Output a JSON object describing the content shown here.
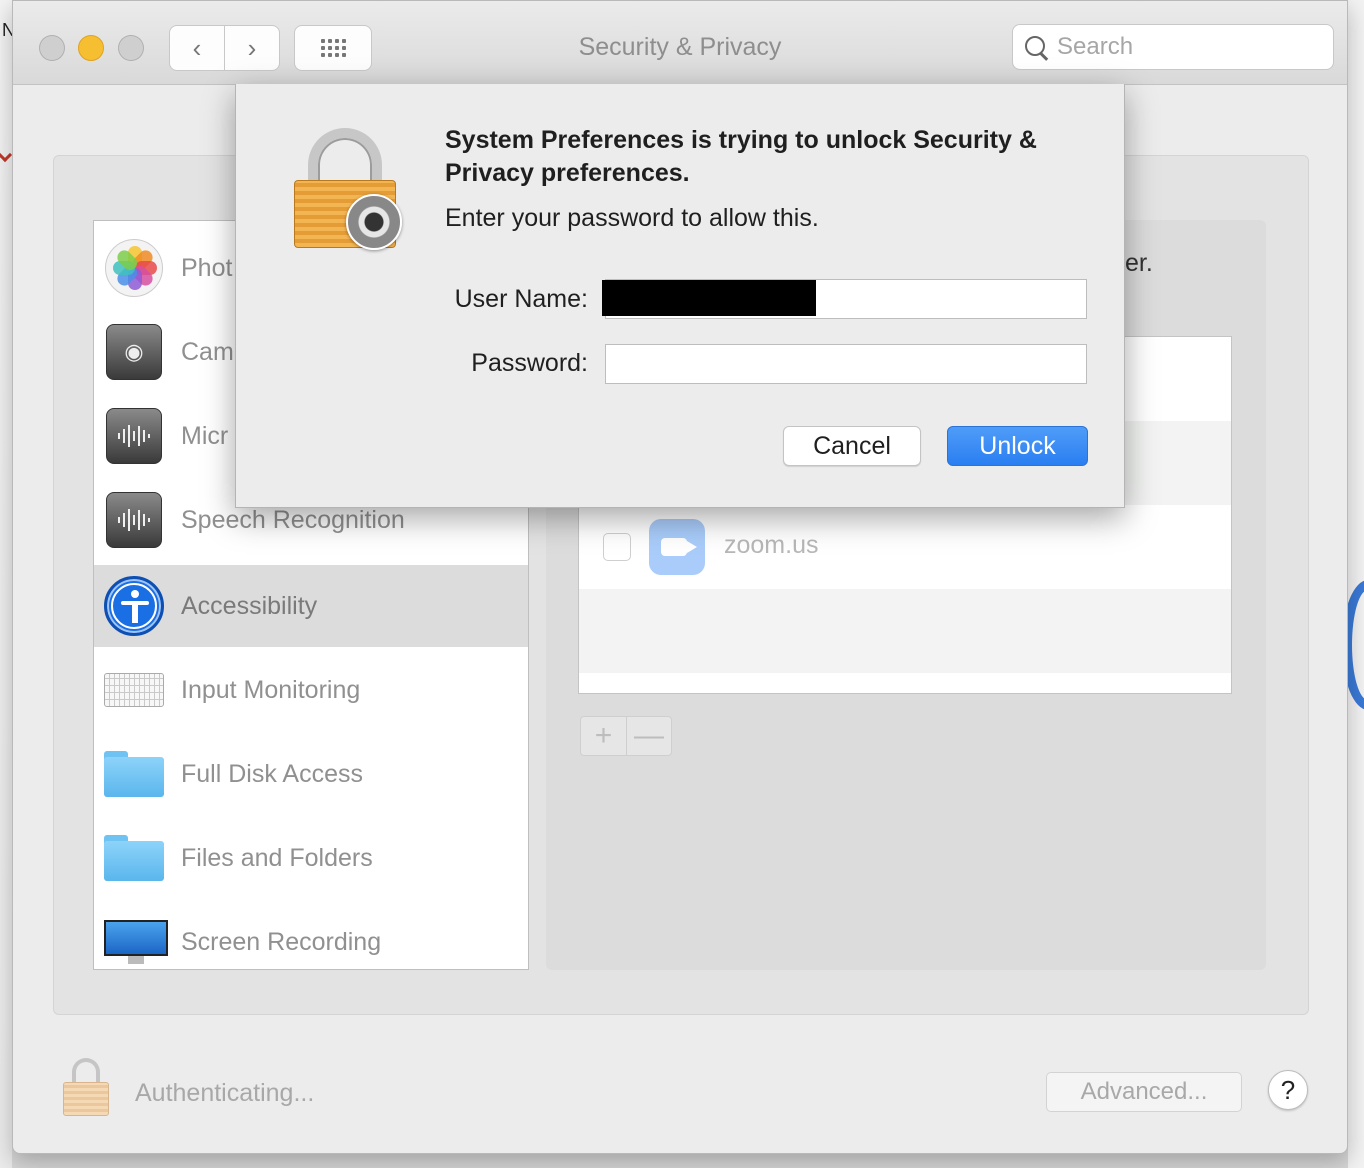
{
  "window": {
    "title": "Security & Privacy",
    "search_placeholder": "Search"
  },
  "toolbar": {
    "back_icon": "chevron-left",
    "forward_icon": "chevron-right",
    "grid_icon": "show-all-grid"
  },
  "sidebar": {
    "items": [
      {
        "label": "Phot",
        "icon": "photos-icon"
      },
      {
        "label": "Cam",
        "icon": "camera-icon"
      },
      {
        "label": "Micr",
        "icon": "microphone-icon"
      },
      {
        "label": "Speech Recognition",
        "icon": "speech-recognition-icon"
      },
      {
        "label": "Accessibility",
        "icon": "accessibility-icon",
        "selected": true
      },
      {
        "label": "Input Monitoring",
        "icon": "keyboard-icon"
      },
      {
        "label": "Full Disk Access",
        "icon": "folder-icon"
      },
      {
        "label": "Files and Folders",
        "icon": "folder-icon"
      },
      {
        "label": "Screen Recording",
        "icon": "display-icon"
      }
    ]
  },
  "main": {
    "hint_fragment": "er.",
    "apps": [
      {
        "name": "zoom.us",
        "checked": false,
        "icon": "zoom-video-icon"
      }
    ],
    "add_label": "+",
    "remove_label": "—"
  },
  "footer": {
    "status": "Authenticating...",
    "advanced_label": "Advanced...",
    "help_label": "?"
  },
  "dialog": {
    "title": "System Preferences is trying to unlock Security & Privacy preferences.",
    "subtitle": "Enter your password to allow this.",
    "username_label": "User Name:",
    "password_label": "Password:",
    "username_value": "",
    "password_value": "",
    "cancel_label": "Cancel",
    "unlock_label": "Unlock"
  },
  "colors": {
    "accent": "#2a7ef1",
    "minimize": "#f5bf31",
    "selection": "#dcdcdc"
  }
}
